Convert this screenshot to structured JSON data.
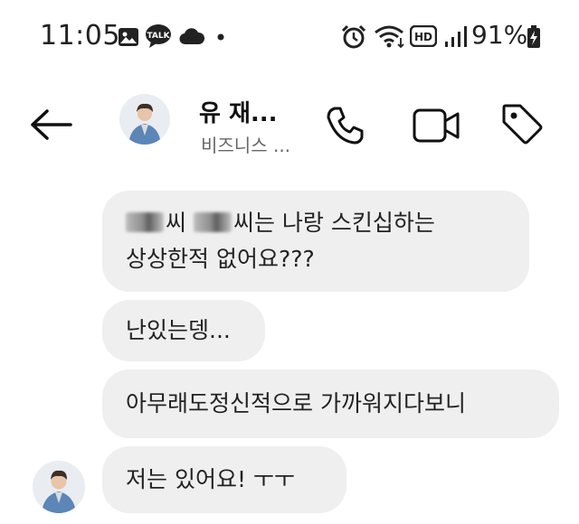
{
  "status_bar": {
    "time": "11:05",
    "battery": "91%",
    "left_icons": [
      "gallery-icon",
      "kakaotalk-icon",
      "cloud-icon",
      "dot-icon"
    ],
    "right_icons": [
      "alarm-icon",
      "wifi-icon",
      "hd-icon",
      "signal-icon",
      "battery-charging-icon"
    ],
    "talk_badge": "TALK",
    "hd_badge": "HD"
  },
  "header": {
    "contact_name": "유 재...",
    "contact_subtitle": "비즈니스 ...",
    "icons": [
      "back-arrow-icon",
      "phone-icon",
      "video-call-icon",
      "tag-icon"
    ]
  },
  "messages": [
    {
      "sender": "me",
      "line1_a": "씨 ",
      "line1_b": "씨는 나랑 스킨십하는",
      "line2": "상상한적 없어요???"
    },
    {
      "sender": "me",
      "text": "난있는뎅..."
    },
    {
      "sender": "me",
      "text": "아무래도정신적으로 가까워지다보니"
    },
    {
      "sender": "contact",
      "text": "저는 있어요! ㅜㅜ"
    }
  ],
  "colors": {
    "bubble": "#efefef",
    "text": "#222222",
    "background": "#ffffff"
  }
}
